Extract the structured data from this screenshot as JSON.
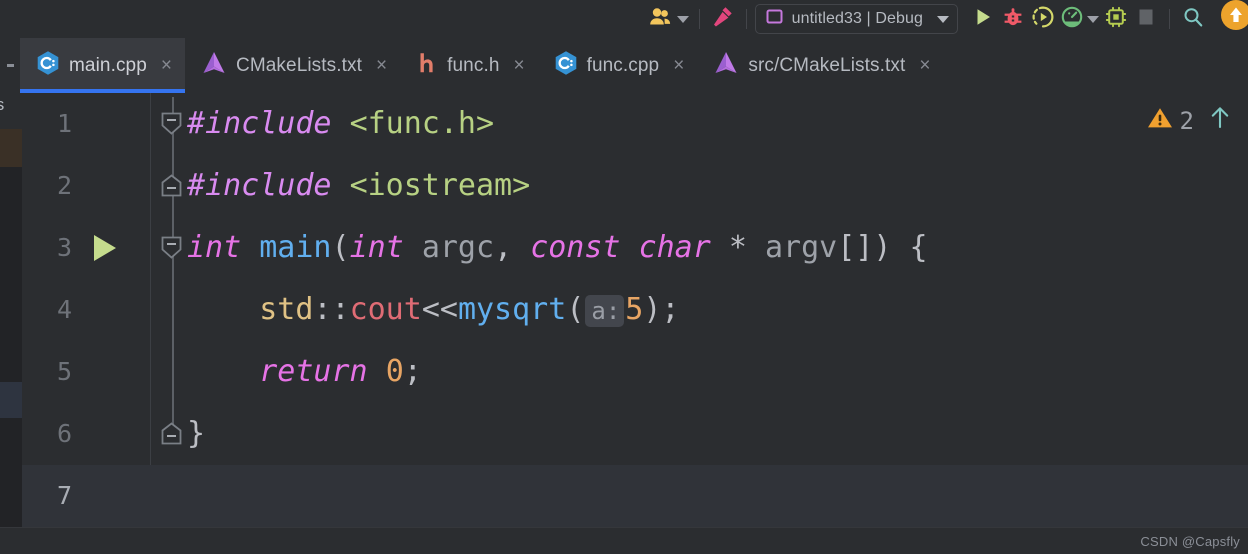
{
  "toolbar": {
    "people_icon": "people-icon",
    "people_dropdown": "chevron-down-icon",
    "build_icon": "hammer-icon",
    "run_config": {
      "icon": "project-square-icon",
      "label": "untitled33 | Debug",
      "dropdown": "chevron-down-icon"
    },
    "run_button": "run-play-icon",
    "debug_button": "debug-bug-icon",
    "run_with_coverage_button": "run-coverage-icon",
    "profiler_button": "profiler-gauge-icon",
    "profiler_dropdown": "chevron-down-icon",
    "memory_button": "memory-chip-icon",
    "stop_button": "stop-square-icon",
    "search_button": "search-icon",
    "update_button": "update-arrow-icon"
  },
  "tabs": [
    {
      "label": "main.cpp",
      "icon": "cpp-file-icon",
      "icon_color": "#3592d4",
      "active": true,
      "close": "×"
    },
    {
      "label": "CMakeLists.txt",
      "icon": "cmake-file-icon",
      "icon_color": "#b36fe0",
      "active": false,
      "close": "×"
    },
    {
      "label": "func.h",
      "icon": "h-file-icon",
      "icon_color": "#e27d6a",
      "active": false,
      "close": "×"
    },
    {
      "label": "func.cpp",
      "icon": "cpp-file-icon",
      "icon_color": "#3592d4",
      "active": false,
      "close": "×"
    },
    {
      "label": "src/CMakeLists.txt",
      "icon": "cmake-file-icon",
      "icon_color": "#b36fe0",
      "active": false,
      "close": "×"
    }
  ],
  "left_stripe": {
    "truncated_label": "ts"
  },
  "editor": {
    "inspection": {
      "warning_icon": "warning-triangle-icon",
      "warning_count": "2",
      "next_error_icon": "arrow-up-icon"
    },
    "line_numbers": [
      "1",
      "2",
      "3",
      "4",
      "5",
      "6",
      "7"
    ],
    "current_line": 7,
    "run_gutter_line": 3,
    "fold_marker_lines": [
      1,
      2,
      3,
      6
    ],
    "code": {
      "l1": {
        "directive": "#include",
        "space": " ",
        "header": "<func.h>"
      },
      "l2": {
        "directive": "#include",
        "space": " ",
        "header": "<iostream>"
      },
      "l3": {
        "kw_int": "int",
        "sp1": " ",
        "fn_main": "main",
        "paren_open": "(",
        "kw_int2": "int",
        "sp2": " ",
        "param_argc": "argc",
        "comma": ", ",
        "kw_const": "const",
        "sp3": " ",
        "kw_char": "char",
        "star": " * ",
        "param_argv": "argv",
        "brackets": "[])",
        "brace_open": " {"
      },
      "l4": {
        "indent": "    ",
        "ns_std": "std",
        "scope": "::",
        "member_cout": "cout",
        "shift": "<<",
        "fn_mysqrt": "mysqrt",
        "paren_open": "(",
        "inlay_hint": "a:",
        "arg": "5",
        "tail": ");"
      },
      "l5": {
        "indent": "    ",
        "kw_return": "return",
        "sp": " ",
        "value": "0",
        "semi": ";"
      },
      "l6": {
        "brace_close": "}"
      },
      "l7": {
        "text": ""
      }
    }
  },
  "watermark": {
    "text": "CSDN @Capsfly"
  },
  "colors": {
    "accent_blue": "#3574f0",
    "editor_bg": "#2b2d30",
    "tab_active_bg": "#393b40",
    "current_line_bg": "#303339",
    "keyword": "#cf8ef7",
    "string": "#b7d183",
    "function": "#61afef",
    "number": "#e8a564",
    "warning": "#f0a732"
  }
}
